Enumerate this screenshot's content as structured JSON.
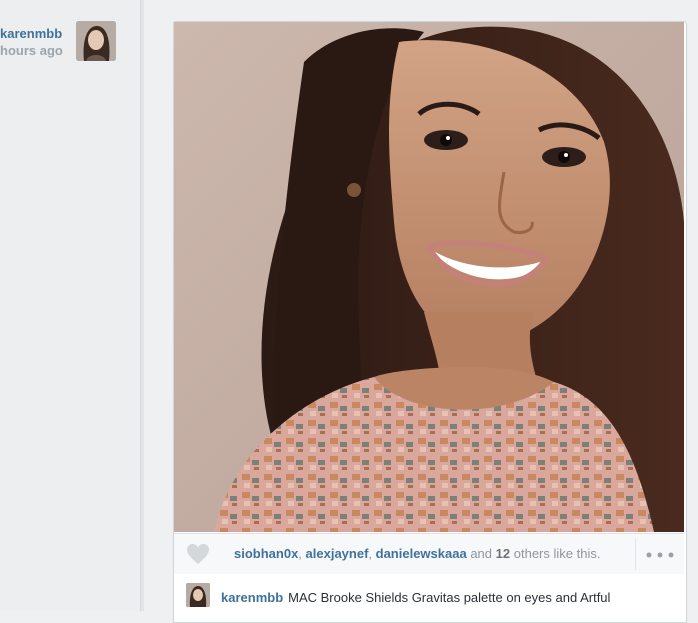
{
  "author": {
    "username": "karenmbb",
    "timestamp": "hours ago"
  },
  "likes": {
    "users": [
      "siobhan0x",
      "alexjaynef",
      "danielewskaaa"
    ],
    "separator": ", ",
    "and_text": "and",
    "others_count": "12",
    "others_text": "others like this."
  },
  "caption": {
    "username": "karenmbb",
    "text": "MAC Brooke Shields Gravitas palette on eyes and Artful"
  },
  "icons": {
    "like": "heart-icon",
    "more": "more-options-icon"
  },
  "colors": {
    "link": "#3f729b",
    "muted": "#9aa5ad",
    "background": "#eef0f1"
  }
}
